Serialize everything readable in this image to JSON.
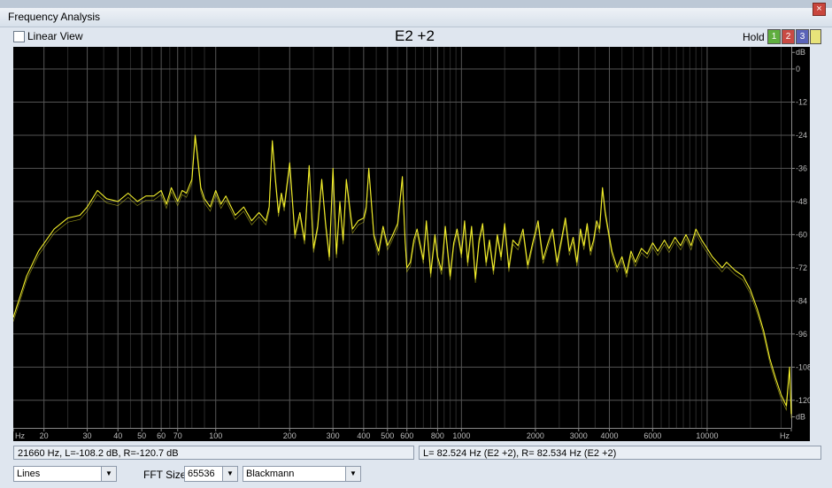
{
  "window": {
    "title": "Frequency Analysis",
    "close_glyph": "×"
  },
  "controls": {
    "linear_view_label": "Linear View",
    "note": "E2 +2",
    "hold_label": "Hold",
    "hold_buttons": [
      {
        "label": "1",
        "color": "#5fae3e"
      },
      {
        "label": "2",
        "color": "#c94a44"
      },
      {
        "label": "3",
        "color": "#5a63b8"
      }
    ],
    "color_picker_color": "#e8e37a"
  },
  "status": {
    "cursor_readout": "21660 Hz, L=-108.2 dB, R=-120.7 dB",
    "peak_readout": "L= 82.524 Hz (E2 +2), R= 82.534 Hz (E2 +2)"
  },
  "bottom": {
    "display_mode": "Lines",
    "fft_size_label": "FFT Size",
    "fft_size": "65536",
    "window_function": "Blackmann"
  },
  "chart_data": {
    "type": "line",
    "x_scale": "log",
    "xlim": [
      15,
      22000
    ],
    "ylim": [
      -130,
      8
    ],
    "x_ticks": [
      {
        "value": 15,
        "label": "Hz"
      },
      {
        "value": 20,
        "label": "20"
      },
      {
        "value": 30,
        "label": "30"
      },
      {
        "value": 40,
        "label": "40"
      },
      {
        "value": 50,
        "label": "50"
      },
      {
        "value": 60,
        "label": "60"
      },
      {
        "value": 70,
        "label": "70"
      },
      {
        "value": 100,
        "label": "100"
      },
      {
        "value": 200,
        "label": "200"
      },
      {
        "value": 300,
        "label": "300"
      },
      {
        "value": 400,
        "label": "400"
      },
      {
        "value": 500,
        "label": "500"
      },
      {
        "value": 600,
        "label": "600"
      },
      {
        "value": 800,
        "label": "800"
      },
      {
        "value": 1000,
        "label": "1000"
      },
      {
        "value": 2000,
        "label": "2000"
      },
      {
        "value": 3000,
        "label": "3000"
      },
      {
        "value": 4000,
        "label": "4000"
      },
      {
        "value": 6000,
        "label": "6000"
      },
      {
        "value": 10000,
        "label": "10000"
      },
      {
        "value": 22000,
        "label": "Hz"
      }
    ],
    "x_minor_grid": [
      25,
      35,
      45,
      55,
      65,
      75,
      80,
      90,
      150,
      250,
      350,
      450,
      550,
      650,
      700,
      750,
      850,
      900,
      950,
      1500,
      2500,
      3500,
      4500,
      5000,
      5500,
      6500,
      7000,
      7500,
      8000,
      8500,
      9000,
      9500,
      15000,
      20000
    ],
    "y_ticks": [
      {
        "value": 6,
        "label": "dB"
      },
      {
        "value": 0,
        "label": "0"
      },
      {
        "value": -12,
        "label": "-12"
      },
      {
        "value": -24,
        "label": "-24"
      },
      {
        "value": -36,
        "label": "-36"
      },
      {
        "value": -48,
        "label": "-48"
      },
      {
        "value": -60,
        "label": "-60"
      },
      {
        "value": -72,
        "label": "-72"
      },
      {
        "value": -84,
        "label": "-84"
      },
      {
        "value": -96,
        "label": "-96"
      },
      {
        "value": -108,
        "label": "-108"
      },
      {
        "value": -120,
        "label": "-120"
      },
      {
        "value": -126,
        "label": "dB"
      }
    ],
    "line_color": "#f2ee2b",
    "grid_color": "#3a3a3a",
    "series": [
      {
        "x": [
          15,
          17,
          19,
          22,
          25,
          28,
          30,
          33,
          36,
          40,
          44,
          48,
          52,
          56,
          60,
          63,
          66,
          70,
          73,
          76,
          80,
          82.5,
          84,
          87,
          90,
          95,
          100,
          105,
          110,
          120,
          130,
          140,
          150,
          160,
          165,
          170,
          175,
          180,
          185,
          190,
          200,
          210,
          220,
          230,
          240,
          250,
          260,
          270,
          280,
          290,
          300,
          310,
          320,
          330,
          340,
          360,
          380,
          400,
          410,
          420,
          440,
          460,
          480,
          500,
          520,
          550,
          575,
          590,
          600,
          620,
          640,
          660,
          700,
          720,
          750,
          780,
          800,
          830,
          860,
          900,
          930,
          960,
          1000,
          1030,
          1060,
          1100,
          1140,
          1180,
          1220,
          1260,
          1300,
          1350,
          1400,
          1450,
          1500,
          1560,
          1620,
          1700,
          1780,
          1860,
          1950,
          2050,
          2150,
          2250,
          2350,
          2450,
          2550,
          2650,
          2750,
          2850,
          2950,
          3050,
          3150,
          3250,
          3350,
          3450,
          3550,
          3650,
          3750,
          3850,
          3950,
          4100,
          4300,
          4500,
          4700,
          4900,
          5100,
          5400,
          5700,
          6000,
          6300,
          6700,
          7000,
          7400,
          7800,
          8200,
          8600,
          9000,
          9500,
          10000,
          10500,
          11000,
          11500,
          12000,
          13000,
          14000,
          15000,
          16000,
          17000,
          18000,
          19000,
          20000,
          21000,
          21660,
          22000
        ],
        "y": [
          -90,
          -75,
          -66,
          -58,
          -54,
          -53,
          -50,
          -44,
          -47,
          -48,
          -45,
          -48,
          -46,
          -46,
          -44,
          -49,
          -43,
          -48,
          -44,
          -45,
          -40,
          -24,
          -30,
          -43,
          -47,
          -50,
          -44,
          -49,
          -46,
          -53,
          -50,
          -55,
          -52,
          -55,
          -50,
          -26,
          -40,
          -52,
          -45,
          -50,
          -34,
          -60,
          -52,
          -62,
          -35,
          -65,
          -57,
          -40,
          -56,
          -68,
          -36,
          -67,
          -48,
          -62,
          -40,
          -58,
          -55,
          -54,
          -50,
          -36,
          -60,
          -66,
          -57,
          -64,
          -61,
          -56,
          -39,
          -62,
          -72,
          -70,
          -62,
          -58,
          -69,
          -55,
          -74,
          -60,
          -68,
          -73,
          -57,
          -75,
          -63,
          -58,
          -67,
          -55,
          -70,
          -57,
          -76,
          -62,
          -56,
          -70,
          -62,
          -73,
          -60,
          -68,
          -56,
          -72,
          -62,
          -64,
          -58,
          -71,
          -63,
          -55,
          -69,
          -63,
          -58,
          -70,
          -62,
          -54,
          -66,
          -61,
          -70,
          -58,
          -64,
          -56,
          -66,
          -62,
          -55,
          -58,
          -43,
          -52,
          -58,
          -66,
          -72,
          -68,
          -74,
          -66,
          -70,
          -65,
          -67,
          -63,
          -66,
          -62,
          -65,
          -61,
          -64,
          -60,
          -64,
          -58,
          -62,
          -65,
          -68,
          -70,
          -72,
          -70,
          -73,
          -75,
          -80,
          -87,
          -95,
          -105,
          -112,
          -118,
          -122,
          -108,
          -125
        ]
      }
    ]
  }
}
